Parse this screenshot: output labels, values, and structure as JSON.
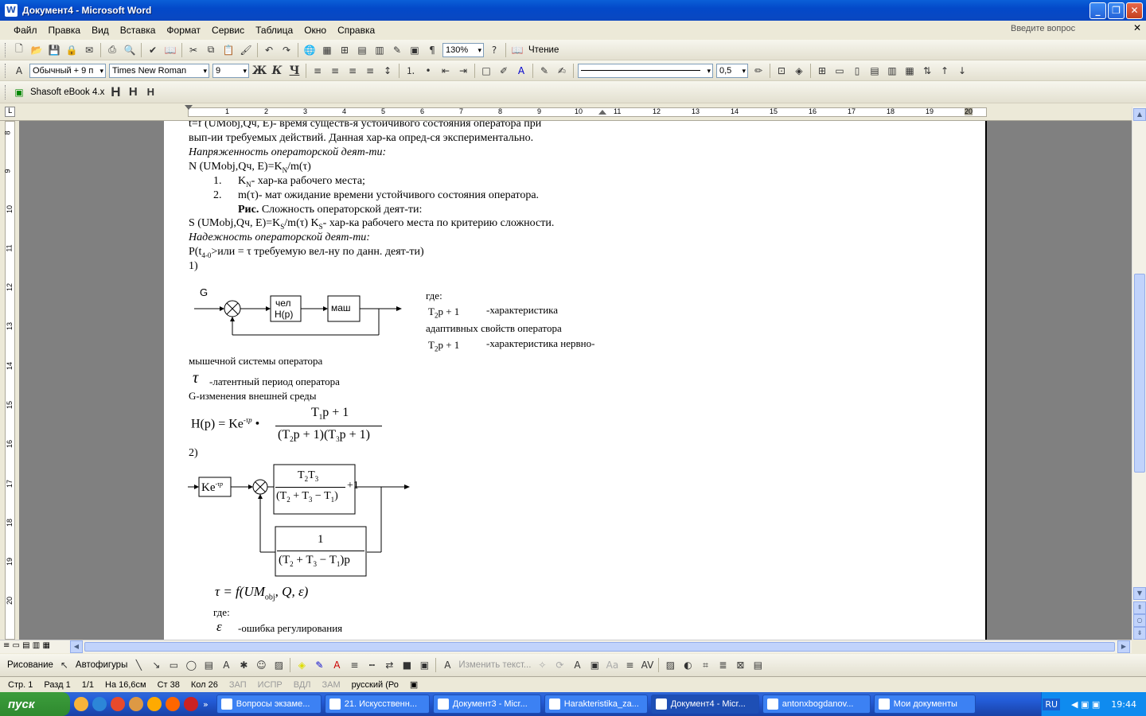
{
  "window": {
    "title": "Документ4 - Microsoft Word"
  },
  "menu": [
    "Файл",
    "Правка",
    "Вид",
    "Вставка",
    "Формат",
    "Сервис",
    "Таблица",
    "Окно",
    "Справка"
  ],
  "ask": {
    "placeholder": "Введите вопрос"
  },
  "toolbar": {
    "zoom": "130%",
    "reading": "Чтение",
    "style": "Обычный + 9 п",
    "font": "Times New Roman",
    "size": "9",
    "linewidth": "0,5"
  },
  "toolbar3": {
    "addon": "Shasoft eBook 4.x",
    "h1": "H",
    "h2": "H",
    "h3": "H"
  },
  "ruler_h": [
    "1",
    "2",
    "3",
    "4",
    "5",
    "6",
    "7",
    "8",
    "9",
    "10",
    "11",
    "12",
    "13",
    "14",
    "15",
    "16",
    "17",
    "18",
    "19",
    "20"
  ],
  "ruler_v": [
    "8",
    "9",
    "10",
    "11",
    "12",
    "13",
    "14",
    "15",
    "16",
    "17",
    "18",
    "19",
    "20"
  ],
  "doc": {
    "l1": "t=f (UMobj,Qч, E)- время существ-я устойчивого состояния оператора при",
    "l2": "вып-ии требуемых действий. Данная хар-ка опред-ся экспериментально.",
    "l3": "Напряженность операторской деят-ти:",
    "l4": "N (UMobj,Qч, E)=K",
    "l4sub": "N",
    "l4end": "/m(τ)",
    "n1": "1.",
    "l5a": "K",
    "l5sub": "N",
    "l5b": "- хар-ка рабочего места;",
    "n2": "2.",
    "l6": "m(τ)- мат ожидание времени устойчивого состояния оператора.",
    "l7b": "Рис.",
    "l7": " Сложность операторской деят-ти:",
    "l8a": "S (UMobj,Qч, E)=K",
    "l8sub": "S",
    "l8b": "/m(τ) K",
    "l8sub2": "S",
    "l8c": "- хар-ка рабочего места по критерию сложности.",
    "l9": "Надежность операторской деят-ти:",
    "l10a": "P(t",
    "l10sub": "4-0",
    "l10b": ">или = τ требуемую вел-ну по данн. деят-ти)",
    "l11": "1)",
    "g": "G",
    "chel": "чел",
    "hp": "H(p)",
    "mash": "маш",
    "gde": "где:",
    "t2p": "T",
    "t2sub": "2",
    "t2rest": "p + 1",
    "ch1": "-характеристика",
    "ch2": "адаптивных свойств оператора",
    "ch3": "-характеристика нервно-",
    "ch4": "мышечной системы оператора",
    "tau": "τ",
    "lat": "-латентный период оператора",
    "gch": "G-изменения внешней среды",
    "f_hp": "H(p) = Ke",
    "f_exp": "-τp",
    "f_num": "T",
    "f_num_sub": "1",
    "f_num_rest": "p + 1",
    "f_den": "(T",
    "f_den_sub": "2",
    "f_den_mid": "p + 1)(T",
    "f_den_sub2": "3",
    "f_den_end": "p + 1)",
    "l12": "2)",
    "ke": "Ke",
    "ke_exp": "-τp",
    "b_num": "T",
    "b_num_sub": "2",
    "b_num2": "T",
    "b_num_sub2": "3",
    "b_den": "(T",
    "b_plus1": "+1",
    "b_one": "1",
    "b_den2": "(T",
    "b_den2_rest": "p",
    "tf_a": "τ = f(UM",
    "tf_sub": "obj",
    "tf_b": ", Q, ε)",
    "gde2": "где:",
    "eps": "ε",
    "err": "-ошибка регулирования"
  },
  "drawbar": {
    "draw": "Рисование",
    "autoshapes": "Автофигуры",
    "edit_text": "Изменить текст..."
  },
  "status": {
    "page": "Стр. 1",
    "section": "Разд 1",
    "pages": "1/1",
    "at": "На 16,6см",
    "line": "Ст 38",
    "col": "Кол 26",
    "rec": "ЗАП",
    "trk": "ИСПР",
    "ext": "ВДЛ",
    "ovr": "ЗАМ",
    "lang": "русский (Ро"
  },
  "taskbar": {
    "start": "пуск",
    "tasks": [
      "Вопросы экзаме...",
      "21. Искусственн...",
      "Документ3 - Micr...",
      "Harakteristika_za...",
      "Документ4 - Micr...",
      "antonxbogdanov...",
      "Мои документы"
    ],
    "lang": "RU",
    "clock": "19:44"
  }
}
